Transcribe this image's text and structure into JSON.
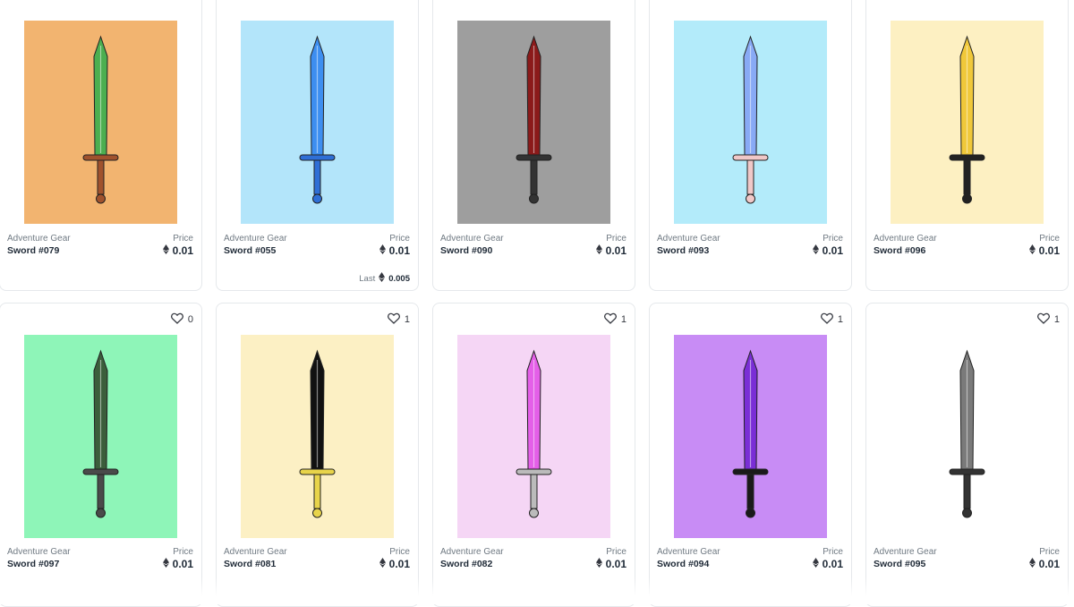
{
  "cards": [
    {
      "collection": "Adventure Gear",
      "name": "Sword #079",
      "price_label": "Price",
      "price": "0.01",
      "bg": "#f2b470",
      "blade": "#4caf50",
      "hilt": "#a0522d"
    },
    {
      "collection": "Adventure Gear",
      "name": "Sword #055",
      "price_label": "Price",
      "price": "0.01",
      "last_label": "Last",
      "last_price": "0.005",
      "bg": "#b3e5fa",
      "blade": "#3d8ef0",
      "hilt": "#2f6fd6"
    },
    {
      "collection": "Adventure Gear",
      "name": "Sword #090",
      "price_label": "Price",
      "price": "0.01",
      "bg": "#9e9e9e",
      "blade": "#8b1a1a",
      "hilt": "#333333"
    },
    {
      "collection": "Adventure Gear",
      "name": "Sword #093",
      "price_label": "Price",
      "price": "0.01",
      "bg": "#b3ebfa",
      "blade": "#88aaf5",
      "hilt": "#f0c8c8"
    },
    {
      "collection": "Adventure Gear",
      "name": "Sword #096",
      "price_label": "Price",
      "price": "0.01",
      "bg": "#fdf0c2",
      "blade": "#f0c83a",
      "hilt": "#222222"
    },
    {
      "favorites": "0",
      "collection": "Adventure Gear",
      "name": "Sword #097",
      "price_label": "Price",
      "price": "0.01",
      "bg": "#8ef5b8",
      "blade": "#3b5e3b",
      "hilt": "#4a4a4a"
    },
    {
      "favorites": "1",
      "collection": "Adventure Gear",
      "name": "Sword #081",
      "price_label": "Price",
      "price": "0.01",
      "bg": "#fcf0c4",
      "blade": "#111111",
      "hilt": "#e8d44a"
    },
    {
      "favorites": "1",
      "collection": "Adventure Gear",
      "name": "Sword #082",
      "price_label": "Price",
      "price": "0.01",
      "bg": "#f5d6f5",
      "blade": "#e45fe8",
      "hilt": "#bbbbbb"
    },
    {
      "favorites": "1",
      "collection": "Adventure Gear",
      "name": "Sword #094",
      "price_label": "Price",
      "price": "0.01",
      "bg": "#c88cf5",
      "blade": "#7a2ed6",
      "hilt": "#1a1a1a"
    },
    {
      "favorites": "1",
      "collection": "Adventure Gear",
      "name": "Sword #095",
      "price_label": "Price",
      "price": "0.01",
      "bg": "#ffffff",
      "blade": "#7a7a7a",
      "hilt": "#333333"
    }
  ]
}
